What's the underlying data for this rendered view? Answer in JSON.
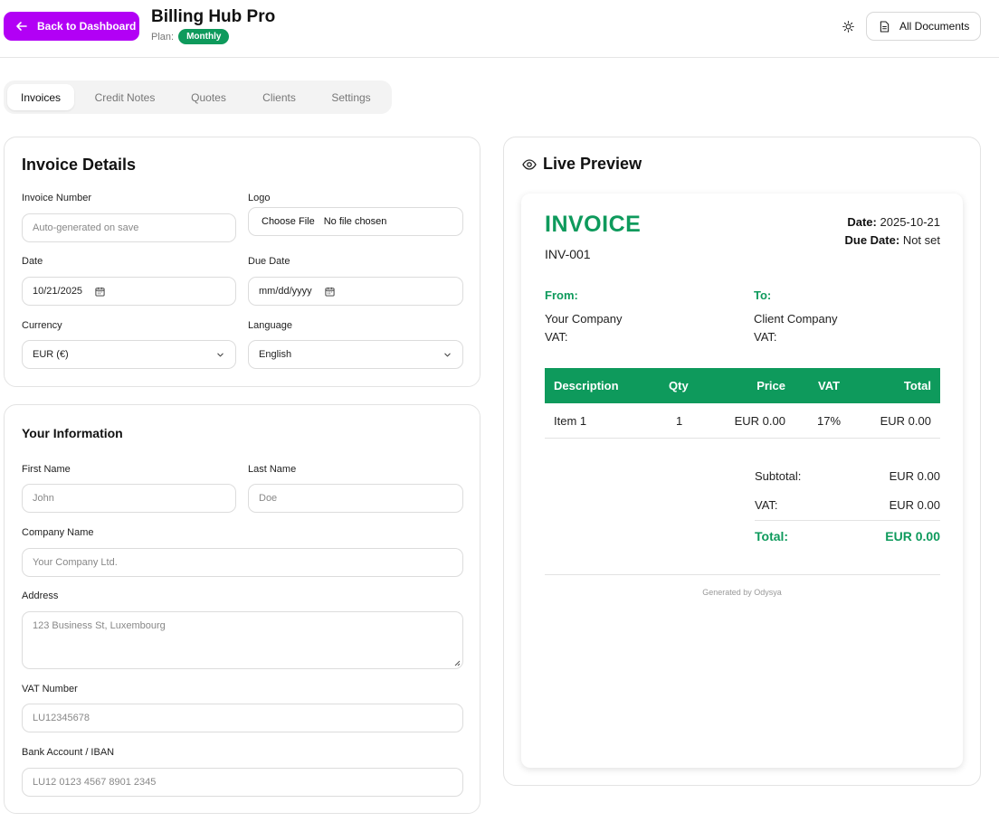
{
  "header": {
    "back_label": "Back to Dashboard",
    "app_title": "Billing Hub Pro",
    "plan_label": "Plan:",
    "plan_badge": "Monthly",
    "docs_label": "All Documents"
  },
  "tabs": [
    {
      "label": "Invoices",
      "active": true
    },
    {
      "label": "Credit Notes",
      "active": false
    },
    {
      "label": "Quotes",
      "active": false
    },
    {
      "label": "Clients",
      "active": false
    },
    {
      "label": "Settings",
      "active": false
    }
  ],
  "invoice_details": {
    "title": "Invoice Details",
    "invoice_number_label": "Invoice Number",
    "invoice_number_placeholder": "Auto-generated on save",
    "logo_label": "Logo",
    "file_button": "Choose File",
    "file_status": "No file chosen",
    "date_label": "Date",
    "date_value": "10/21/2025",
    "due_date_label": "Due Date",
    "due_date_value": "mm/dd/yyyy",
    "currency_label": "Currency",
    "currency_value": "EUR (€)",
    "language_label": "Language",
    "language_value": "English"
  },
  "your_information": {
    "title": "Your Information",
    "first_name_label": "First Name",
    "first_name_placeholder": "John",
    "last_name_label": "Last Name",
    "last_name_placeholder": "Doe",
    "company_label": "Company Name",
    "company_placeholder": "Your Company Ltd.",
    "address_label": "Address",
    "address_placeholder": "123 Business St, Luxembourg",
    "vat_label": "VAT Number",
    "vat_placeholder": "LU12345678",
    "bank_label": "Bank Account / IBAN",
    "bank_placeholder": "LU12 0123 4567 8901 2345"
  },
  "preview": {
    "title": "Live Preview",
    "heading": "INVOICE",
    "number": "INV-001",
    "date_label": "Date:",
    "date_value": "2025-10-21",
    "due_label": "Due Date:",
    "due_value": "Not set",
    "from_label": "From:",
    "from_company": "Your Company",
    "from_vat": "VAT:",
    "to_label": "To:",
    "to_company": "Client Company",
    "to_vat": "VAT:",
    "columns": {
      "description": "Description",
      "qty": "Qty",
      "price": "Price",
      "vat": "VAT",
      "total": "Total"
    },
    "items": [
      {
        "description": "Item 1",
        "qty": "1",
        "price": "EUR 0.00",
        "vat": "17%",
        "total": "EUR 0.00"
      }
    ],
    "subtotal_label": "Subtotal:",
    "subtotal_value": "EUR 0.00",
    "vat_label": "VAT:",
    "vat_value": "EUR 0.00",
    "total_label": "Total:",
    "total_value": "EUR 0.00",
    "footer": "Generated by Odysya"
  },
  "colors": {
    "accent_purple": "#b200f5",
    "brand_green": "#0e9a5c"
  },
  "icons": [
    "arrow-left-icon",
    "sun-icon",
    "document-icon",
    "calendar-icon",
    "chevron-down-icon",
    "eye-icon",
    "resize-handle-icon"
  ]
}
